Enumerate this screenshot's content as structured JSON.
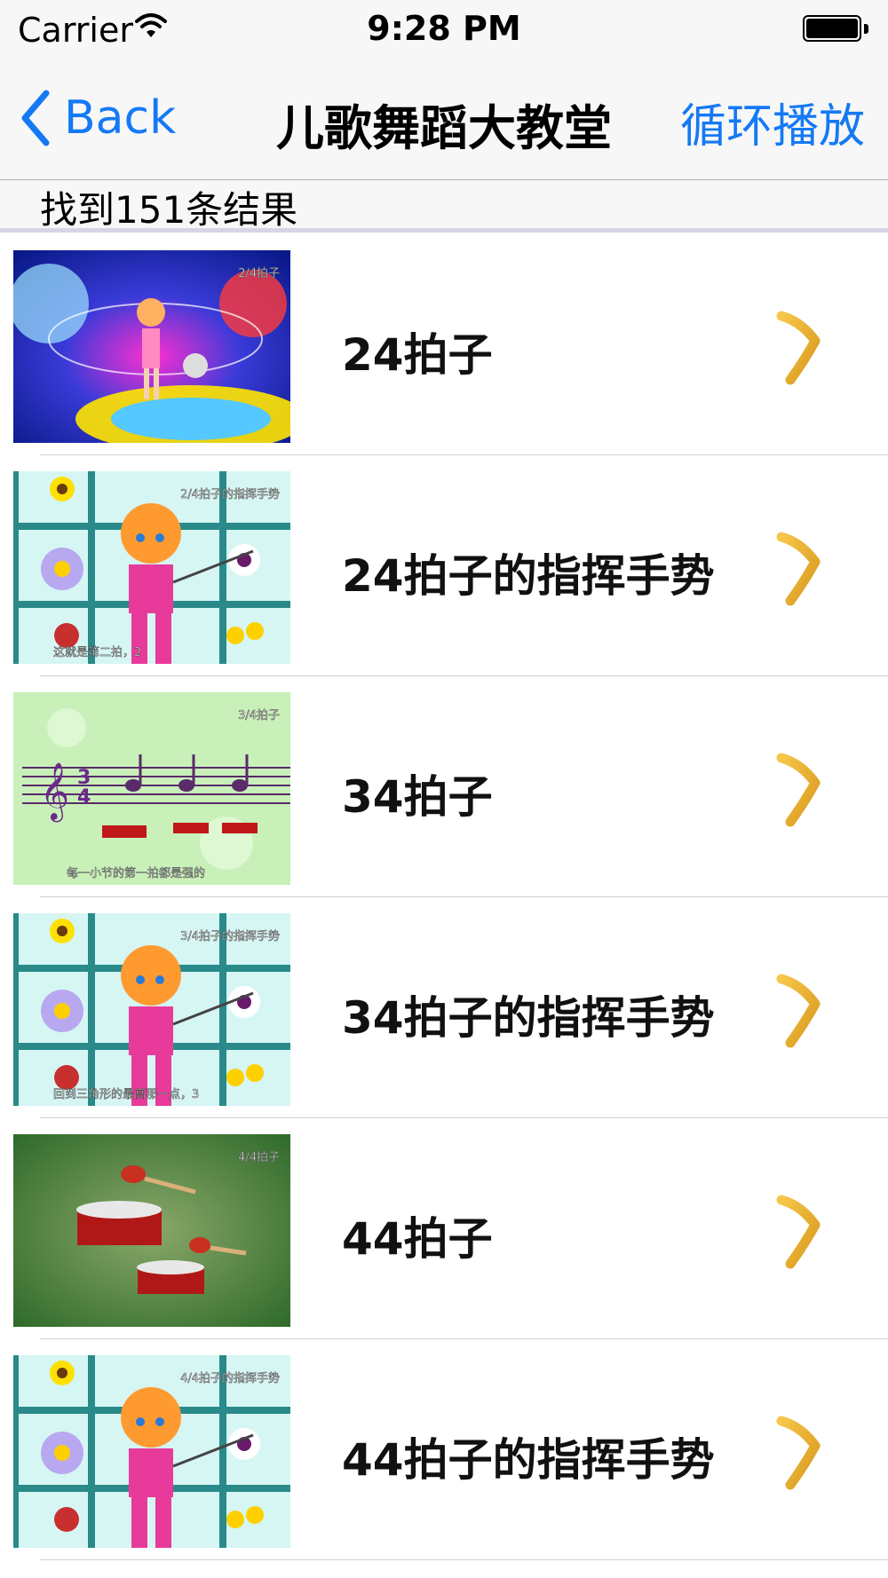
{
  "status_bar": {
    "carrier": "Carrier",
    "time": "9:28 PM"
  },
  "nav_bar": {
    "back_label": "Back",
    "title": "儿歌舞蹈大教堂",
    "right_button_label": "循环播放",
    "tint_color": "#1479f5"
  },
  "results": {
    "count_text": "找到151条结果"
  },
  "videos": [
    {
      "title": "24拍子",
      "thumb": "space-stage",
      "thumb_caption": "2/4拍子",
      "thumb_subtitle": ""
    },
    {
      "title": "24拍子的指挥手势",
      "thumb": "flower-grid",
      "thumb_caption": "2/4拍子的指挥手势",
      "thumb_subtitle": "这就是第二拍，2"
    },
    {
      "title": "34拍子",
      "thumb": "music-staff",
      "thumb_caption": "3/4拍子",
      "thumb_subtitle": "每一小节的第一拍都是强的"
    },
    {
      "title": "34拍子的指挥手势",
      "thumb": "flower-grid",
      "thumb_caption": "3/4拍子的指挥手势",
      "thumb_subtitle": "回到三角形的最高那一点，3"
    },
    {
      "title": "44拍子",
      "thumb": "drums-green",
      "thumb_caption": "4/4拍子",
      "thumb_subtitle": ""
    },
    {
      "title": "44拍子的指挥手势",
      "thumb": "flower-grid",
      "thumb_caption": "4/4拍子的指挥手势",
      "thumb_subtitle": ""
    }
  ],
  "accessory_icon": "orange-chevron-icon",
  "accent_colors": {
    "chevron": "#d99a1e",
    "grid_line": "#2a8a8a"
  }
}
